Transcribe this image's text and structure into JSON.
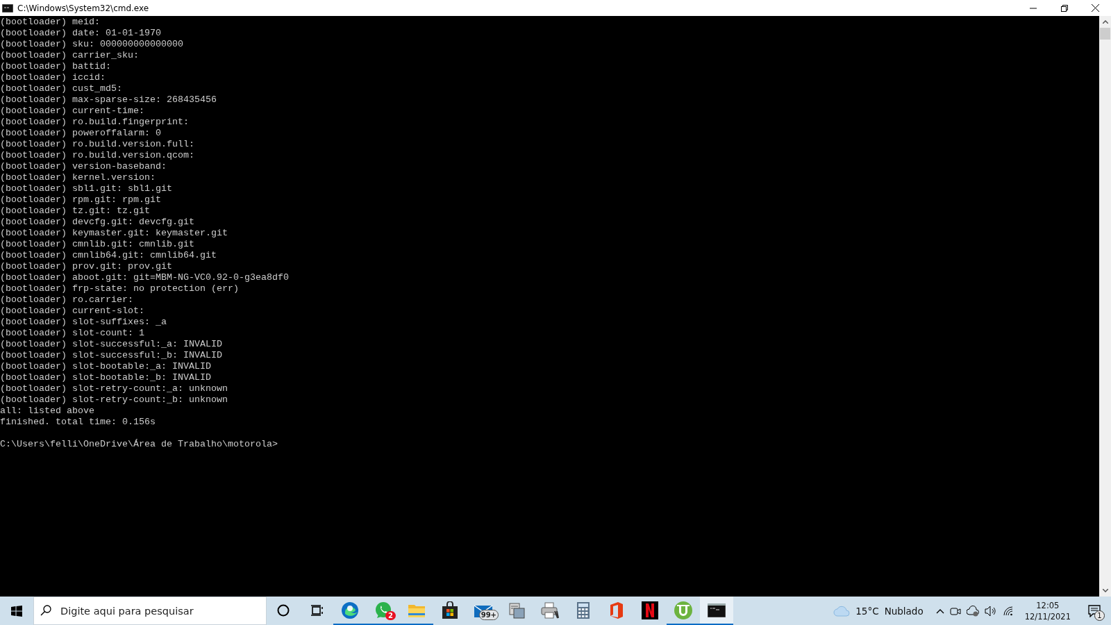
{
  "window": {
    "title": "C:\\Windows\\System32\\cmd.exe"
  },
  "console": {
    "lines": [
      "(bootloader) meid:",
      "(bootloader) date: 01-01-1970",
      "(bootloader) sku: 000000000000000",
      "(bootloader) carrier_sku:",
      "(bootloader) battid:",
      "(bootloader) iccid:",
      "(bootloader) cust_md5:",
      "(bootloader) max-sparse-size: 268435456",
      "(bootloader) current-time:",
      "(bootloader) ro.build.fingerprint:",
      "(bootloader) poweroffalarm: 0",
      "(bootloader) ro.build.version.full:",
      "(bootloader) ro.build.version.qcom:",
      "(bootloader) version-baseband:",
      "(bootloader) kernel.version:",
      "(bootloader) sbl1.git: sbl1.git",
      "(bootloader) rpm.git: rpm.git",
      "(bootloader) tz.git: tz.git",
      "(bootloader) devcfg.git: devcfg.git",
      "(bootloader) keymaster.git: keymaster.git",
      "(bootloader) cmnlib.git: cmnlib.git",
      "(bootloader) cmnlib64.git: cmnlib64.git",
      "(bootloader) prov.git: prov.git",
      "(bootloader) aboot.git: git=MBM-NG-VC0.92-0-g3ea8df0",
      "(bootloader) frp-state: no protection (err)",
      "(bootloader) ro.carrier:",
      "(bootloader) current-slot:",
      "(bootloader) slot-suffixes: _a",
      "(bootloader) slot-count: 1",
      "(bootloader) slot-successful:_a: INVALID",
      "(bootloader) slot-successful:_b: INVALID",
      "(bootloader) slot-bootable:_a: INVALID",
      "(bootloader) slot-bootable:_b: INVALID",
      "(bootloader) slot-retry-count:_a: unknown",
      "(bootloader) slot-retry-count:_b: unknown",
      "all: listed above",
      "finished. total time: 0.156s"
    ],
    "prompt": "C:\\Users\\felli\\OneDrive\\Área de Trabalho\\motorola>"
  },
  "taskbar": {
    "search": {
      "placeholder": "Digite aqui para pesquisar"
    },
    "apps": [
      {
        "kind": "cortana",
        "running": false,
        "active": false
      },
      {
        "kind": "taskview",
        "running": false,
        "active": false
      },
      {
        "kind": "browser",
        "running": true,
        "active": false
      },
      {
        "kind": "chat",
        "running": true,
        "active": false,
        "badge": "2"
      },
      {
        "kind": "folder",
        "running": true,
        "active": false
      },
      {
        "kind": "store",
        "running": false,
        "active": false
      },
      {
        "kind": "mail",
        "running": false,
        "active": false,
        "badge": "99+"
      },
      {
        "kind": "scanner",
        "running": false,
        "active": false
      },
      {
        "kind": "printer",
        "running": false,
        "active": false
      },
      {
        "kind": "calculator",
        "running": false,
        "active": false
      },
      {
        "kind": "office",
        "running": false,
        "active": false
      },
      {
        "kind": "video",
        "running": false,
        "active": false
      },
      {
        "kind": "torrent",
        "running": true,
        "active": false
      },
      {
        "kind": "terminal",
        "running": true,
        "active": true
      }
    ],
    "weather": {
      "temperature": "15°C",
      "condition": "Nublado"
    },
    "clock": {
      "time": "12:05",
      "date": "12/11/2021"
    },
    "notifications": {
      "count": "1"
    }
  }
}
